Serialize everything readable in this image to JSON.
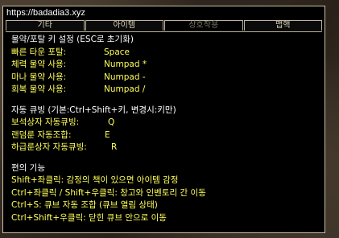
{
  "window": {
    "title": "https://badadia3.xyz",
    "tabs": [
      {
        "label": "기타",
        "active": false
      },
      {
        "label": "아이템",
        "active": false
      },
      {
        "label": "상호작용",
        "active": true
      },
      {
        "label": "맵핵",
        "active": false
      }
    ]
  },
  "sections": {
    "potions": {
      "title": "물약/포탈 키 설정 (ESC로 초기화)",
      "rows": [
        {
          "label": "빠른 타운 포탈:",
          "value": "Space"
        },
        {
          "label": "체력 물약 사용:",
          "value": "Numpad *"
        },
        {
          "label": "마나 물약 사용:",
          "value": "Numpad -"
        },
        {
          "label": "회복 물약 사용:",
          "value": "Numpad /"
        }
      ]
    },
    "cubing": {
      "title": "자동 큐빙 (기본:Ctrl+Shift+키, 변경시:키만)",
      "rows": [
        {
          "label": "보석상자 자동큐빙:",
          "value": "Q"
        },
        {
          "label": "랜덤룬 자동조합:",
          "value": "E"
        },
        {
          "label": "하급룬상자 자동큐빙:",
          "value": "R"
        }
      ]
    },
    "convenience": {
      "title": "편의 기능",
      "lines": [
        "Shift+좌클릭: 감정의 책이 있으면 아이템 감정",
        "Ctrl+좌클릭 / Shift+우클릭: 창고와 인벤토리 간 이동",
        "Ctrl+S: 큐브 자동 조합 (큐브 열림 상태)",
        "Ctrl+Shift+우클릭: 닫힌 큐브 안으로 이동"
      ]
    }
  }
}
